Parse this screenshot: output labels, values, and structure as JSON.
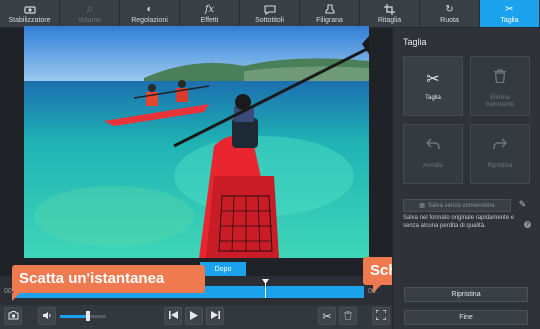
{
  "toolbar": {
    "items": [
      {
        "label": "Stabilizzatore",
        "icon": "stabilizer-icon"
      },
      {
        "label": "Volume",
        "icon": "music-note-icon"
      },
      {
        "label": "Regolazioni",
        "icon": "contrast-icon"
      },
      {
        "label": "Effetti",
        "icon": "fx-icon"
      },
      {
        "label": "Sottotitoli",
        "icon": "speech-bubble-icon"
      },
      {
        "label": "Filigrana",
        "icon": "stamp-icon"
      },
      {
        "label": "Ritaglia",
        "icon": "crop-icon"
      },
      {
        "label": "Ruota",
        "icon": "rotate-icon"
      },
      {
        "label": "Taglia",
        "icon": "scissors-icon"
      }
    ],
    "active": "Taglia"
  },
  "preview": {
    "after_label": "Dopo",
    "time_start": "00",
    "time_end": "00"
  },
  "callouts": {
    "snapshot": "Scatta un'istantanea",
    "fullscreen": "Schermo intero"
  },
  "panel": {
    "title": "Taglia",
    "cut_label": "Taglia",
    "delete_label": "Elimina frammento",
    "undo_label": "Annulla",
    "redo_label": "Ripristina",
    "convert_label": "Salva senza conversione",
    "note": "Salva nel formato originale rapidamente e senza alcuna perdita di qualità.",
    "reset_label": "Ripristina",
    "done_label": "Fine"
  },
  "volume": {
    "level": 0.6
  },
  "colors": {
    "accent": "#1aa3ec",
    "callout": "#ef7a4f"
  }
}
